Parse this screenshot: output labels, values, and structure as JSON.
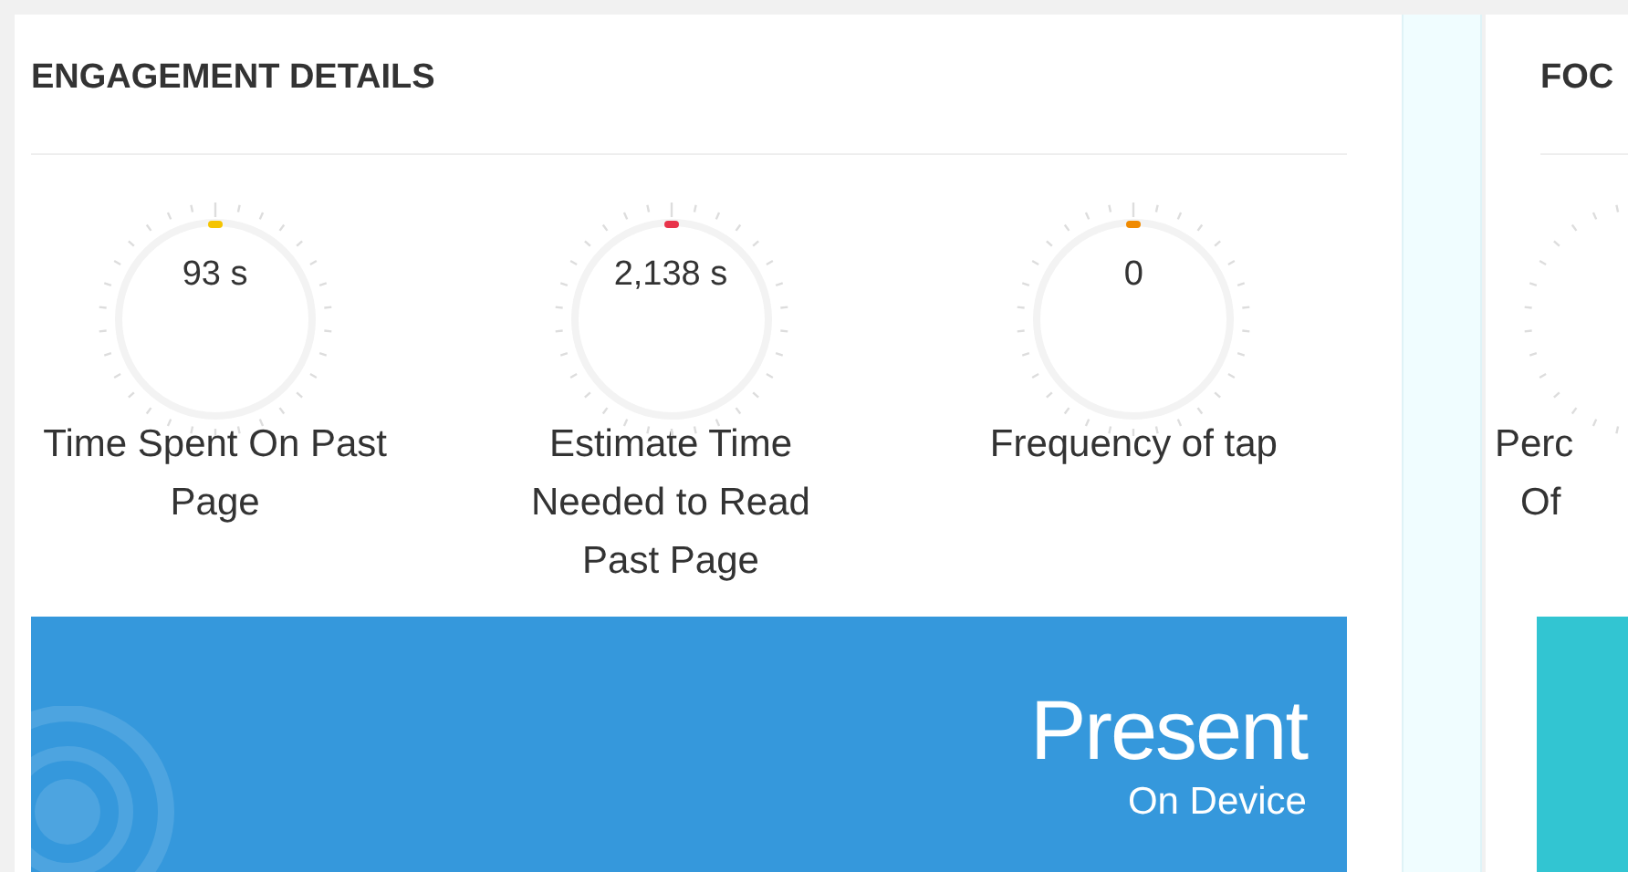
{
  "engagement": {
    "title": "ENGAGEMENT DETAILS",
    "gauges": [
      {
        "value": "93 s",
        "label": "Time Spent On Past Page",
        "color": "#f5c400"
      },
      {
        "value": "2,138 s",
        "label": "Estimate Time Needed to Read Past Page",
        "color": "#e8334a"
      },
      {
        "value": "0",
        "label": "Frequency of tap",
        "color": "#f08a00"
      }
    ],
    "banner": {
      "headline": "Present",
      "subtext": "On Device"
    }
  },
  "focus": {
    "title": "FOC",
    "gauge_label_lines": [
      "Perc",
      "Of"
    ]
  }
}
